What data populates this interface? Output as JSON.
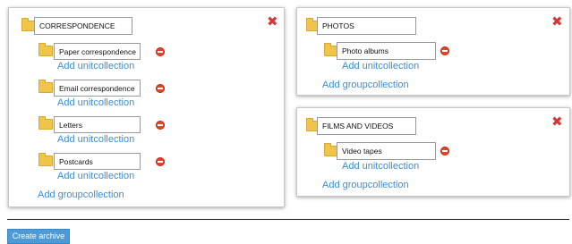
{
  "icons": {
    "folder": "folder-icon",
    "delete": "minus-circle-icon",
    "close": "close-x-icon"
  },
  "colors": {
    "folder": "#f0c64a",
    "link": "#3d8fd0",
    "delete": "#e2452b",
    "close": "#d23a3a",
    "button": "#4d9ad6"
  },
  "groups": [
    {
      "name": "CORRESPONDENCE",
      "close_glyph": "✖",
      "units": [
        {
          "name": "Paper correspondence",
          "delete_glyph": "−",
          "add_link": "Add unitcollection"
        },
        {
          "name": "Email correspondence",
          "delete_glyph": "−",
          "add_link": "Add unitcollection"
        },
        {
          "name": "Letters",
          "delete_glyph": "−",
          "add_link": "Add unitcollection"
        },
        {
          "name": "Postcards",
          "delete_glyph": "−",
          "add_link": "Add unitcollection"
        }
      ],
      "add_group_link": "Add groupcollection"
    },
    {
      "name": "PHOTOS",
      "close_glyph": "✖",
      "units": [
        {
          "name": "Photo albums",
          "delete_glyph": "−",
          "add_link": "Add unitcollection"
        }
      ],
      "add_group_link": "Add groupcollection"
    },
    {
      "name": "FILMS AND VIDEOS",
      "close_glyph": "✖",
      "units": [
        {
          "name": "Video tapes",
          "delete_glyph": "−",
          "add_link": "Add unitcollection"
        }
      ],
      "add_group_link": "Add groupcollection"
    }
  ],
  "actions": {
    "create_archive": "Create archive"
  }
}
